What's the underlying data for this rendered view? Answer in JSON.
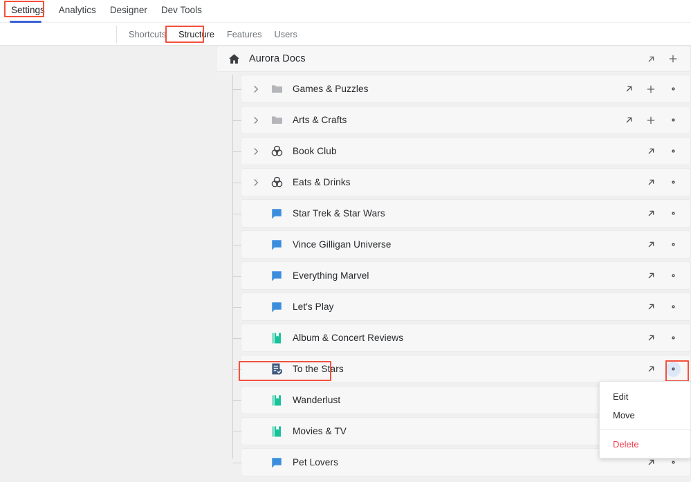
{
  "topnav": {
    "items": [
      {
        "label": "Settings",
        "active": true,
        "annotated": true
      },
      {
        "label": "Analytics",
        "active": false
      },
      {
        "label": "Designer",
        "active": false
      },
      {
        "label": "Dev Tools",
        "active": false
      }
    ],
    "active_underline_color": "#3b5fd4"
  },
  "subnav": {
    "items": [
      {
        "label": "Shortcuts",
        "active": false
      },
      {
        "label": "Structure",
        "active": true,
        "annotated": true
      },
      {
        "label": "Features",
        "active": false
      },
      {
        "label": "Users",
        "active": false
      }
    ]
  },
  "tree": {
    "header": {
      "icon": "home-icon",
      "title": "Aurora Docs",
      "actions": [
        "open-external-icon",
        "add-icon"
      ]
    },
    "rows": [
      {
        "label": "Games & Puzzles",
        "icon": "folder-icon",
        "icon_kind": "folder",
        "chevron": true,
        "actions": [
          "open-external-icon",
          "add-icon",
          "gear-icon"
        ]
      },
      {
        "label": "Arts & Crafts",
        "icon": "folder-icon",
        "icon_kind": "folder",
        "chevron": true,
        "actions": [
          "open-external-icon",
          "add-icon",
          "gear-icon"
        ]
      },
      {
        "label": "Book Club",
        "icon": "group-icon",
        "icon_kind": "group",
        "chevron": true,
        "actions": [
          "open-external-icon",
          "gear-icon"
        ]
      },
      {
        "label": "Eats & Drinks",
        "icon": "group-icon",
        "icon_kind": "group",
        "chevron": true,
        "actions": [
          "open-external-icon",
          "gear-icon"
        ]
      },
      {
        "label": "Star Trek & Star Wars",
        "icon": "chat-bubble-icon",
        "icon_kind": "chat",
        "chevron": false,
        "actions": [
          "open-external-icon",
          "gear-icon"
        ]
      },
      {
        "label": "Vince Gilligan Universe",
        "icon": "chat-bubble-icon",
        "icon_kind": "chat",
        "chevron": false,
        "actions": [
          "open-external-icon",
          "gear-icon"
        ]
      },
      {
        "label": "Everything Marvel",
        "icon": "chat-bubble-icon",
        "icon_kind": "chat",
        "chevron": false,
        "actions": [
          "open-external-icon",
          "gear-icon"
        ]
      },
      {
        "label": "Let's Play",
        "icon": "chat-bubble-icon",
        "icon_kind": "chat",
        "chevron": false,
        "actions": [
          "open-external-icon",
          "gear-icon"
        ]
      },
      {
        "label": "Album & Concert Reviews",
        "icon": "book-icon",
        "icon_kind": "book",
        "chevron": false,
        "actions": [
          "open-external-icon",
          "gear-icon"
        ]
      },
      {
        "label": "To the Stars",
        "icon": "book-verified-icon",
        "icon_kind": "book-verified",
        "chevron": false,
        "selected": true,
        "actions": [
          "open-external-icon",
          "gear-icon"
        ],
        "gear_active": true
      },
      {
        "label": "Wanderlust",
        "icon": "book-icon",
        "icon_kind": "book",
        "chevron": false,
        "actions": [
          "open-external-icon",
          "gear-icon"
        ]
      },
      {
        "label": "Movies & TV",
        "icon": "book-icon",
        "icon_kind": "book",
        "chevron": false,
        "actions": [
          "open-external-icon",
          "gear-icon"
        ]
      },
      {
        "label": "Pet Lovers",
        "icon": "chat-bubble-icon",
        "icon_kind": "chat",
        "chevron": false,
        "actions": [
          "open-external-icon",
          "gear-icon"
        ]
      }
    ]
  },
  "context_menu": {
    "items": [
      {
        "label": "Edit",
        "danger": false
      },
      {
        "label": "Move",
        "danger": false
      },
      {
        "label": "Delete",
        "danger": true
      }
    ]
  },
  "colors": {
    "page_background": "#f0f0f0",
    "row_background": "#f7f7f7",
    "chat_icon": "#3b8ede",
    "book_icon": "#18c39a",
    "book_verified_icon": "#3f5a7d",
    "folder_icon": "#b4b6b9",
    "delete_text": "#f0394d",
    "annotation_box": "#f4503c",
    "gear_active_background": "#dce8f8"
  }
}
